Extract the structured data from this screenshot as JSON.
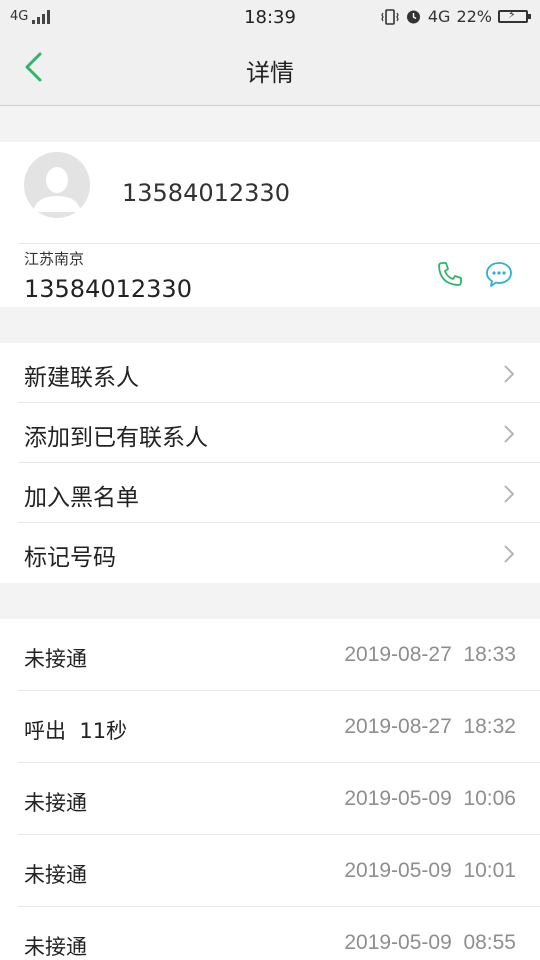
{
  "status_bar": {
    "network_left": "4G",
    "time": "18:39",
    "network_right": "4G",
    "battery": "22%"
  },
  "header": {
    "title": "详情"
  },
  "contact": {
    "number": "13584012330",
    "location": "江苏南京",
    "phone": "13584012330"
  },
  "actions": [
    {
      "label": "新建联系人"
    },
    {
      "label": "添加到已有联系人"
    },
    {
      "label": "加入黑名单"
    },
    {
      "label": "标记号码"
    }
  ],
  "call_log": [
    {
      "type": "未接通",
      "date": "2019-08-27",
      "time": "18:33"
    },
    {
      "type": "呼出  11秒",
      "date": "2019-08-27",
      "time": "18:32"
    },
    {
      "type": "未接通",
      "date": "2019-05-09",
      "time": "10:06"
    },
    {
      "type": "未接通",
      "date": "2019-05-09",
      "time": "10:01"
    },
    {
      "type": "未接通",
      "date": "2019-05-09",
      "time": "08:55"
    }
  ],
  "colors": {
    "accent_green": "#2fb56a",
    "accent_teal": "#29b3d2",
    "secondary_text": "#8e8e8e"
  }
}
